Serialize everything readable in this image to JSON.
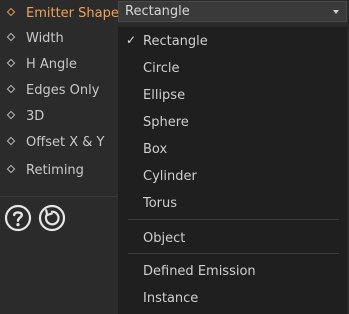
{
  "properties": [
    {
      "label": "Emitter Shape",
      "active": true
    },
    {
      "label": "Width"
    },
    {
      "label": "H Angle"
    },
    {
      "label": "Edges Only"
    },
    {
      "label": "3D"
    },
    {
      "label": "Offset X & Y"
    },
    {
      "label": "Retiming"
    }
  ],
  "icons": [
    "help-icon",
    "reset-icon"
  ],
  "dropdown": {
    "value": "Rectangle"
  },
  "menu": {
    "selected": "Rectangle",
    "check_glyph": "✓",
    "groups": [
      [
        "Rectangle",
        "Circle",
        "Ellipse",
        "Sphere",
        "Box",
        "Cylinder",
        "Torus"
      ],
      [
        "Object"
      ],
      [
        "Defined Emission",
        "Instance"
      ]
    ]
  },
  "colors": {
    "accent": "#f0a25a",
    "menu_bg": "#1f1f1f",
    "panel_bg": "#2b2b2b"
  }
}
